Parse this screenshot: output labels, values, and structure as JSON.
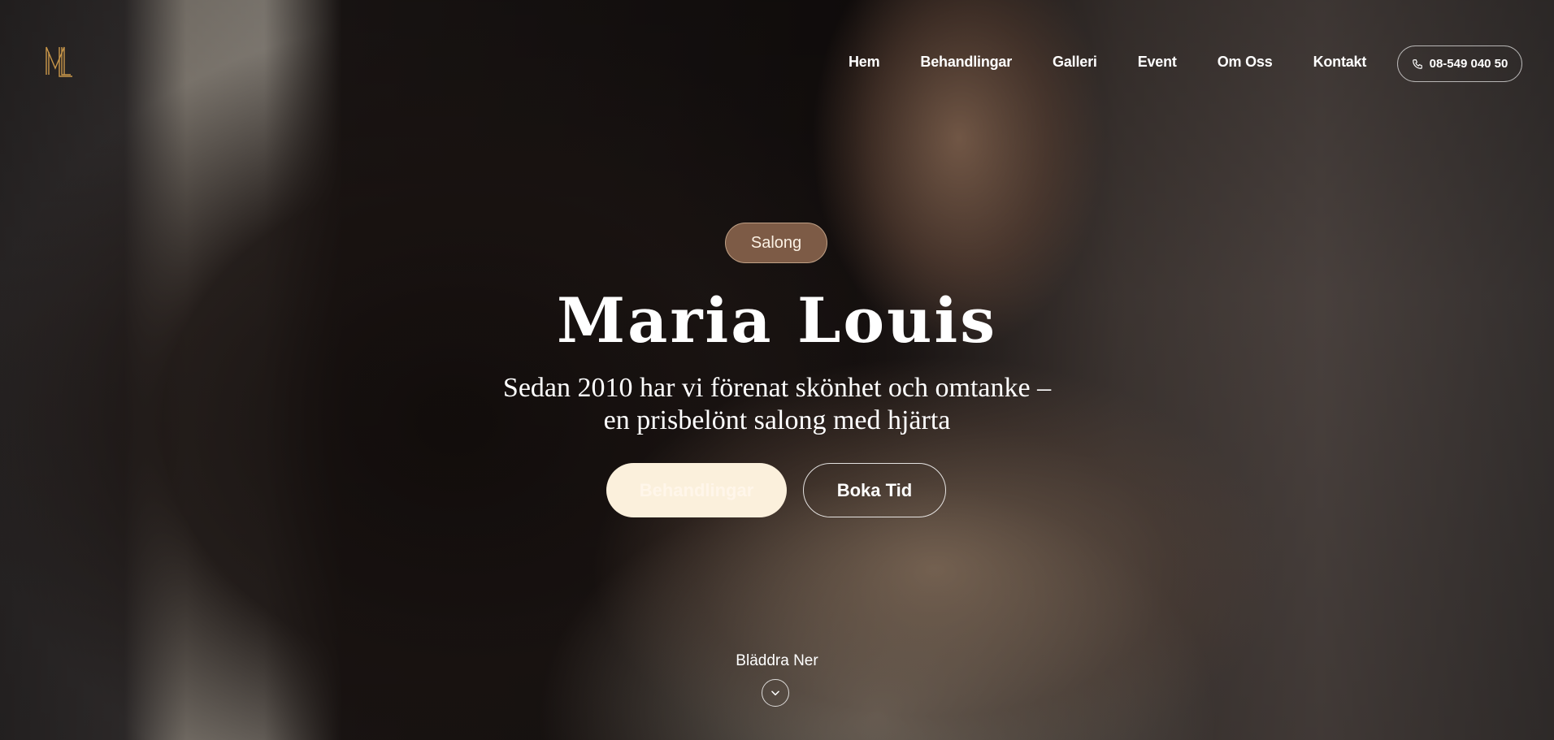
{
  "nav": {
    "items": [
      {
        "label": "Hem"
      },
      {
        "label": "Behandlingar"
      },
      {
        "label": "Galleri"
      },
      {
        "label": "Event"
      },
      {
        "label": "Om Oss"
      },
      {
        "label": "Kontakt"
      }
    ],
    "phone": "08-549 040 50",
    "phone_icon": "phone-icon",
    "logo_text": "ML"
  },
  "hero": {
    "badge": "Salong",
    "title": "Maria Louis",
    "subtitle_line1": "Sedan 2010 har vi förenat skönhet och omtanke –",
    "subtitle_line2": "en prisbelönt salong med hjärta",
    "primary_button": "Behandlingar",
    "secondary_button": "Boka Tid",
    "scroll_label": "Bläddra Ner",
    "scroll_icon": "chevron-down-icon"
  },
  "colors": {
    "accent": "#c9974a",
    "badge_bg": "#8f6850",
    "primary_button_bg": "#fbf0dc"
  }
}
